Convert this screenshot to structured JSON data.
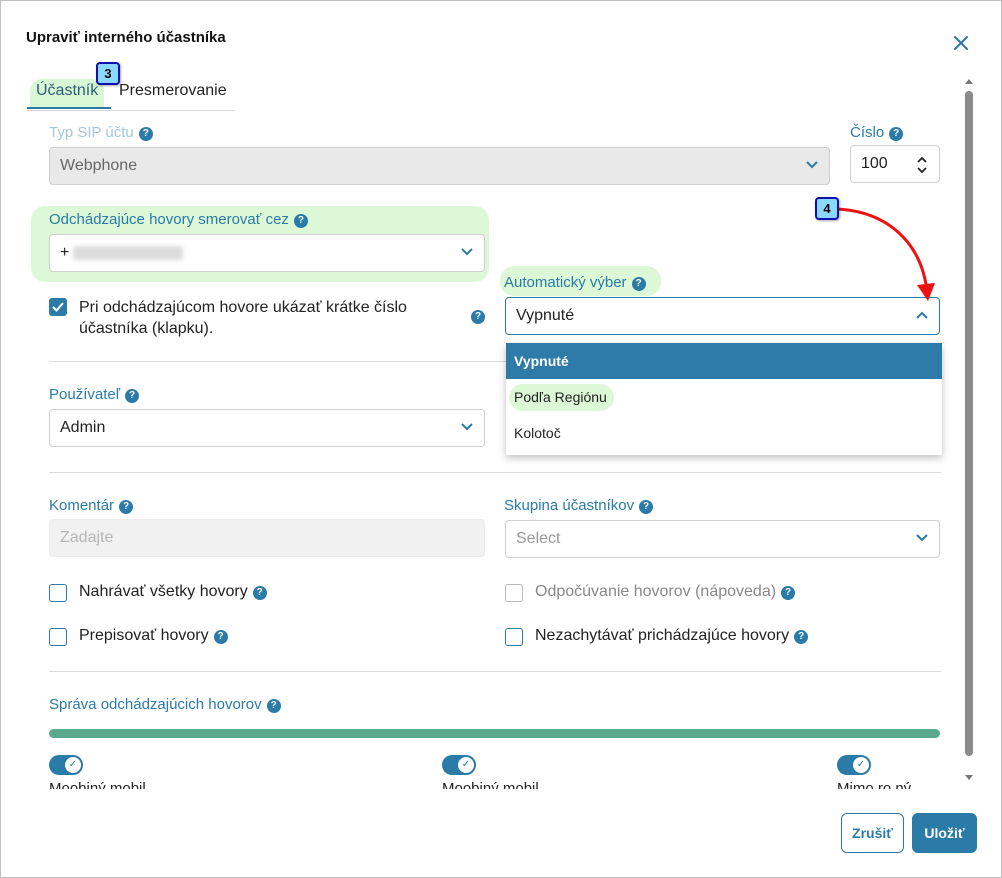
{
  "dialog": {
    "title": "Upraviť interného účastníka"
  },
  "tabs": [
    {
      "label": "Účastník",
      "active": true
    },
    {
      "label": "Presmerovanie",
      "active": false
    }
  ],
  "annotations": {
    "badge_tab": "3",
    "badge_dropdown": "4"
  },
  "sip_type": {
    "label": "Typ SIP účtu",
    "value": "Webphone"
  },
  "number": {
    "label": "Číslo",
    "value": "100"
  },
  "outgoing_route": {
    "label": "Odchádzajúce hovory smerovať cez",
    "value_prefix": "+"
  },
  "auto_select": {
    "label": "Automatický výber",
    "value": "Vypnuté",
    "options": [
      "Vypnuté",
      "Podľa Regiónu",
      "Kolotoč"
    ],
    "selected_index": 0
  },
  "show_extension": {
    "label": "Pri odchádzajúcom hovore ukázať krátke číslo účastníka (klapku).",
    "line1": "Pri odchádzajúcom hovore ukázať krátke číslo",
    "line2": "účastníka (klapku).",
    "checked": true
  },
  "user": {
    "label": "Používateľ",
    "value": "Admin"
  },
  "comment": {
    "label": "Komentár",
    "placeholder": "Zadajte"
  },
  "group": {
    "label": "Skupina účastníkov",
    "placeholder": "Select"
  },
  "checkboxes": {
    "record_all": "Nahrávať všetky hovory",
    "overwrite": "Prepisovať hovory",
    "eavesdrop": "Odpočúvanie hovorov (nápoveda)",
    "no_intercept": "Nezachytávať prichádzajúce hovory"
  },
  "outgoing_mgmt": {
    "label": "Správa odchádzajúcich hovorov",
    "progress": 1.0
  },
  "buttons": {
    "cancel": "Zrušiť",
    "save": "Uložiť"
  },
  "colors": {
    "accent": "#2b7ba8",
    "highlight": "#dcf8d6",
    "selected_option": "#2e7aa9",
    "progress": "#5aa98c"
  }
}
